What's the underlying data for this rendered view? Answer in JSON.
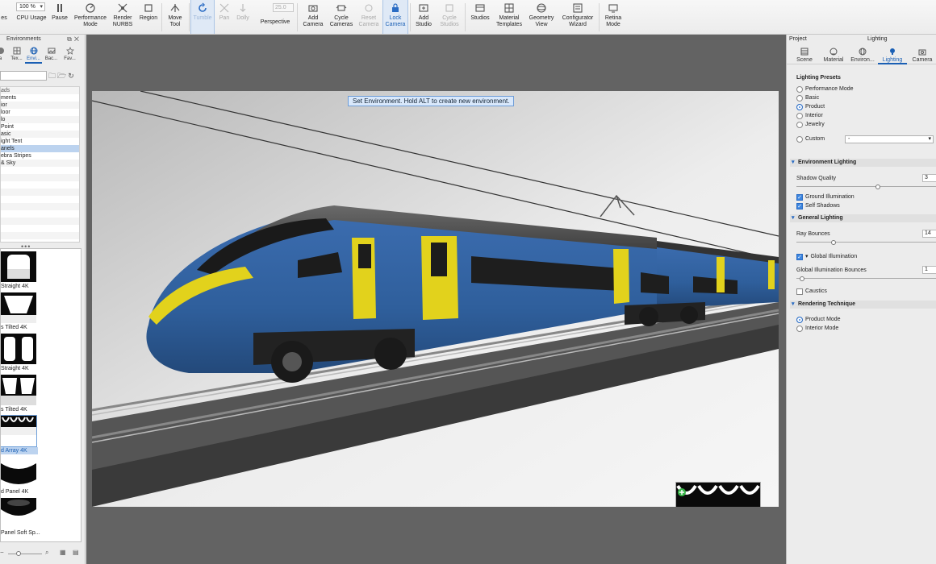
{
  "toolbar": {
    "zoom_value": "100 %",
    "tumble_value": "25.0",
    "buttons": [
      {
        "label": "es",
        "icon": "scene-icon"
      },
      {
        "label": "CPU Usage",
        "icon": "cpu-icon"
      },
      {
        "label": "Pause",
        "icon": "pause-icon"
      },
      {
        "label": "Performance\nMode",
        "icon": "performance-icon"
      },
      {
        "label": "Render\nNURBS",
        "icon": "nurbs-icon"
      },
      {
        "label": "Region",
        "icon": "region-icon"
      },
      {
        "label": "Move\nTool",
        "icon": "move-tool-icon"
      },
      {
        "label": "Tumble",
        "icon": "tumble-icon"
      },
      {
        "label": "Pan",
        "icon": "pan-icon"
      },
      {
        "label": "Dolly",
        "icon": "dolly-icon"
      },
      {
        "label": "Perspective",
        "icon": "perspective-icon"
      },
      {
        "label": "Add\nCamera",
        "icon": "add-camera-icon"
      },
      {
        "label": "Cycle\nCameras",
        "icon": "cycle-cameras-icon"
      },
      {
        "label": "Reset\nCamera",
        "icon": "reset-camera-icon"
      },
      {
        "label": "Lock\nCamera",
        "icon": "lock-camera-icon"
      },
      {
        "label": "Add\nStudio",
        "icon": "add-studio-icon"
      },
      {
        "label": "Cycle\nStudios",
        "icon": "cycle-studios-icon"
      },
      {
        "label": "Studios",
        "icon": "studios-icon"
      },
      {
        "label": "Material\nTemplates",
        "icon": "material-templates-icon"
      },
      {
        "label": "Geometry\nView",
        "icon": "geometry-view-icon"
      },
      {
        "label": "Configurator\nWizard",
        "icon": "configurator-icon"
      },
      {
        "label": "Retina\nMode",
        "icon": "retina-icon"
      }
    ]
  },
  "left_panel": {
    "title": "Environments",
    "tabs": [
      {
        "label": "a"
      },
      {
        "label": "Tex..."
      },
      {
        "label": "Envi..."
      },
      {
        "label": "Bac..."
      },
      {
        "label": "Fav..."
      }
    ],
    "list": [
      {
        "label": "ads"
      },
      {
        "label": "ments"
      },
      {
        "label": "ior"
      },
      {
        "label": "loor"
      },
      {
        "label": "lo"
      },
      {
        "label": " Point"
      },
      {
        "label": "asic"
      },
      {
        "label": "ight Tent"
      },
      {
        "label": "anels"
      },
      {
        "label": "ebra Stripes"
      },
      {
        "label": "& Sky"
      }
    ],
    "thumbs": [
      {
        "label": "Straight 4K"
      },
      {
        "label": "s Tilted 4K"
      },
      {
        "label": "Straight 4K"
      },
      {
        "label": "s Tilted 4K"
      },
      {
        "label": "d Array 4K"
      },
      {
        "label": "d Panel 4K"
      },
      {
        "label": "Panel Soft Sp..."
      }
    ]
  },
  "viewport": {
    "hint": "Set Environment. Hold ALT to create new environment."
  },
  "right_panel": {
    "project_label": "Project",
    "panel_label": "Lighting",
    "tabs": [
      {
        "label": "Scene"
      },
      {
        "label": "Material"
      },
      {
        "label": "Environ..."
      },
      {
        "label": "Lighting"
      },
      {
        "label": "Camera"
      }
    ],
    "presets_title": "Lighting Presets",
    "presets": [
      {
        "label": "Performance Mode"
      },
      {
        "label": "Basic"
      },
      {
        "label": "Product"
      },
      {
        "label": "Interior"
      },
      {
        "label": "Jewelry"
      }
    ],
    "custom_label": "Custom",
    "custom_value": "-",
    "env_lighting": {
      "title": "Environment Lighting",
      "shadow_quality_label": "Shadow Quality",
      "shadow_quality_value": "3",
      "ground_illumination": "Ground Illumination",
      "self_shadows": "Self Shadows"
    },
    "general_lighting": {
      "title": "General Lighting",
      "ray_bounces_label": "Ray Bounces",
      "ray_bounces_value": "14",
      "global_illumination": "Global Illumination",
      "gi_bounces_label": "Global Illumination Bounces",
      "gi_bounces_value": "1",
      "caustics": "Caustics"
    },
    "rendering_technique": {
      "title": "Rendering Technique",
      "product_mode": "Product Mode",
      "interior_mode": "Interior Mode"
    }
  },
  "colors": {
    "accent": "#1a5fb4",
    "train_blue": "#2f5f9c",
    "train_yellow": "#e2d21c",
    "viewport_bg": "#636363"
  }
}
